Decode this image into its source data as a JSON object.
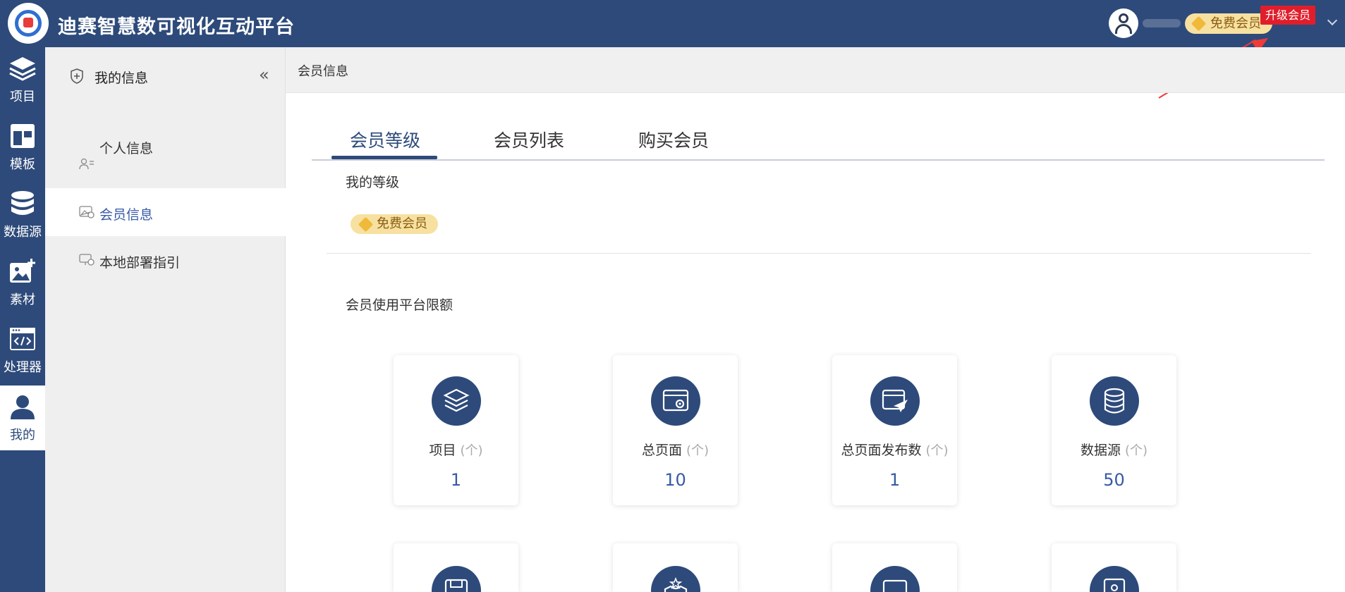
{
  "header": {
    "app_title": "迪赛智慧数可视化互动平台",
    "member_badge": "免费会员",
    "upgrade_label": "升级会员"
  },
  "rail": {
    "items": [
      {
        "label": "项目",
        "icon": "layers-icon"
      },
      {
        "label": "模板",
        "icon": "layout-icon"
      },
      {
        "label": "数据源",
        "icon": "database-icon"
      },
      {
        "label": "素材",
        "icon": "image-plus-icon"
      },
      {
        "label": "处理器",
        "icon": "code-icon"
      },
      {
        "label": "我的",
        "icon": "user-icon",
        "active": true
      }
    ]
  },
  "subnav": {
    "title": "我的信息",
    "items": [
      {
        "label": "个人信息"
      },
      {
        "label": "会员信息",
        "active": true
      },
      {
        "label": "本地部署指引"
      }
    ]
  },
  "breadcrumb": "会员信息",
  "tabs": [
    {
      "label": "会员等级",
      "active": true
    },
    {
      "label": "会员列表"
    },
    {
      "label": "购买会员"
    }
  ],
  "my_level": {
    "title": "我的等级",
    "badge": "免费会员"
  },
  "limits": {
    "title": "会员使用平台限额",
    "unit": "(个)",
    "cards": [
      {
        "name": "项目",
        "value": "1",
        "icon": "layers-icon"
      },
      {
        "name": "总页面",
        "value": "10",
        "icon": "page-settings-icon"
      },
      {
        "name": "总页面发布数",
        "value": "1",
        "icon": "page-send-icon"
      },
      {
        "name": "数据源",
        "value": "50",
        "icon": "database-icon"
      }
    ]
  },
  "colors": {
    "primary": "#2d4a7a",
    "accent": "#3759a6",
    "badge_gold": "#f7e1a1",
    "upgrade_red": "#e01e2b"
  }
}
